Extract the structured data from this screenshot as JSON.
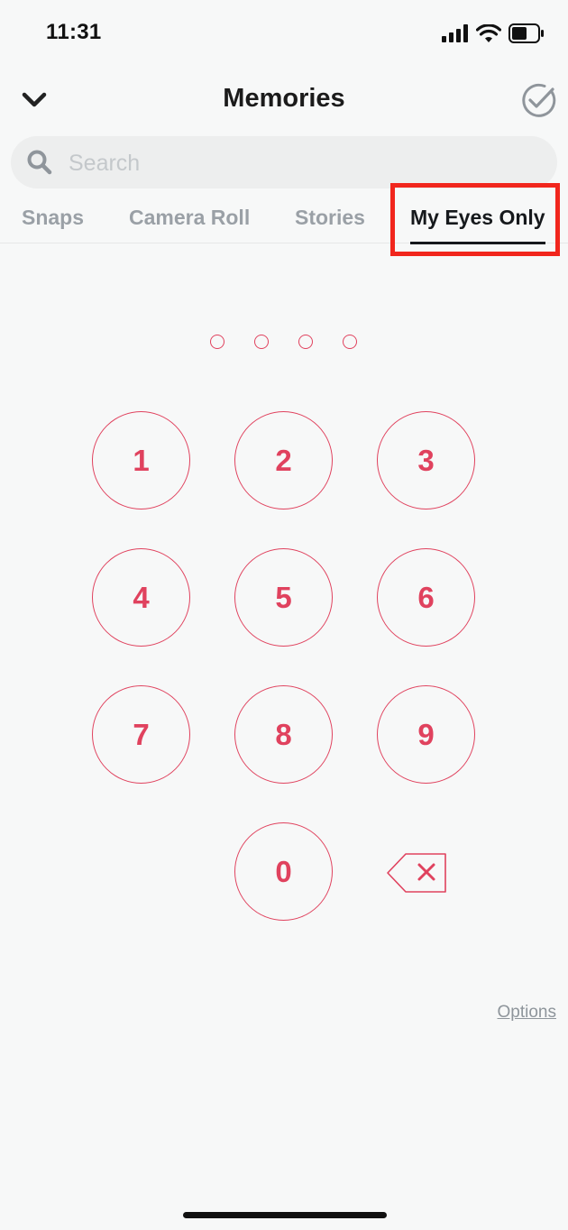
{
  "status_bar": {
    "time": "11:31",
    "icons": [
      "cellular-signal-icon",
      "wifi-icon",
      "battery-icon"
    ]
  },
  "header": {
    "title": "Memories",
    "back_icon": "chevron-down-icon",
    "select_icon": "check-circle-icon"
  },
  "search": {
    "placeholder": "Search",
    "value": ""
  },
  "tabs": [
    {
      "label": "Snaps",
      "active": false
    },
    {
      "label": "Camera Roll",
      "active": false
    },
    {
      "label": "Stories",
      "active": false
    },
    {
      "label": "My Eyes Only",
      "active": true
    }
  ],
  "passcode": {
    "length": 4,
    "entered": 0
  },
  "keypad": {
    "keys": [
      "1",
      "2",
      "3",
      "4",
      "5",
      "6",
      "7",
      "8",
      "9",
      "0"
    ],
    "backspace_icon": "backspace-icon"
  },
  "options_link": "Options",
  "colors": {
    "accent": "#e0425e",
    "highlight_box": "#f1261d",
    "background": "#f7f8f8"
  }
}
